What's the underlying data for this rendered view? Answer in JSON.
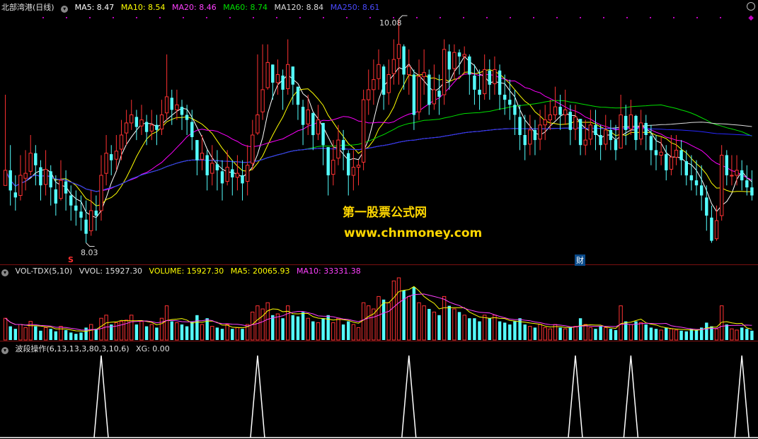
{
  "price_legend": {
    "title": "北部湾港(日线)",
    "ma5": "MA5: 8.47",
    "ma10": "MA10: 8.54",
    "ma20": "MA20: 8.46",
    "ma60": "MA60: 8.74",
    "ma120": "MA120: 8.84",
    "ma250": "MA250: 8.61"
  },
  "vol_legend": {
    "title": "VOL-TDX(5,10)",
    "vvol": "VVOL: 15927.30",
    "volume": "VOLUME: 15927.30",
    "ma5": "MA5: 20065.93",
    "ma10": "MA10: 33331.38"
  },
  "ind_legend": {
    "title": "波段操作(6,13,13,3,80,3,10,6)",
    "xg": "XG: 0.00"
  },
  "annotations": {
    "high": "10.08",
    "low": "8.03",
    "s_mark": "S",
    "cai": "财"
  },
  "watermark": {
    "line1": "第一股票公式网",
    "line2": "www.chnmoney.com"
  },
  "colors": {
    "up": "#ff3232",
    "down": "#54ffff",
    "ma5": "#ffffff",
    "ma10": "#ffff00",
    "ma20": "#ff00ff",
    "ma60": "#00e000",
    "ma120": "#dddddd",
    "ma250": "#2828ff"
  },
  "chart_data": {
    "type": "candlestick",
    "y_range": [
      7.9,
      10.3
    ],
    "close": [
      8.75,
      8.55,
      8.48,
      8.7,
      8.72,
      8.92,
      8.8,
      8.6,
      8.76,
      8.58,
      8.42,
      8.65,
      8.52,
      8.4,
      8.35,
      8.28,
      8.12,
      8.35,
      8.3,
      8.7,
      8.92,
      8.85,
      8.94,
      9.1,
      9.22,
      9.3,
      9.18,
      9.25,
      9.13,
      9.2,
      9.15,
      9.3,
      9.48,
      9.35,
      9.4,
      9.3,
      9.25,
      9.08,
      8.85,
      8.92,
      8.7,
      8.82,
      8.75,
      8.62,
      8.78,
      8.68,
      8.72,
      8.62,
      8.8,
      9.1,
      9.3,
      9.55,
      9.82,
      9.62,
      9.7,
      9.55,
      9.8,
      9.6,
      9.4,
      9.2,
      9.35,
      9.1,
      9.25,
      9.0,
      8.7,
      8.85,
      9.05,
      8.95,
      8.7,
      8.78,
      8.8,
      9.45,
      9.55,
      9.65,
      9.8,
      9.5,
      9.7,
      9.85,
      10.0,
      9.7,
      9.78,
      9.3,
      9.68,
      9.72,
      9.4,
      9.55,
      9.48,
      9.95,
      9.75,
      9.92,
      9.88,
      9.9,
      9.7,
      9.55,
      9.5,
      9.75,
      9.6,
      9.75,
      9.5,
      9.45,
      9.4,
      9.3,
      9.1,
      9.0,
      9.15,
      9.05,
      9.2,
      9.25,
      9.3,
      9.38,
      9.3,
      9.35,
      9.15,
      9.28,
      9.0,
      9.05,
      9.2,
      9.1,
      9.0,
      9.15,
      9.05,
      8.95,
      9.3,
      9.15,
      9.3,
      9.05,
      9.22,
      9.1,
      8.95,
      8.9,
      8.93,
      8.75,
      8.88,
      8.95,
      8.85,
      8.7,
      8.65,
      8.6,
      8.5,
      8.3,
      8.05,
      8.25,
      8.9,
      8.7,
      8.7,
      8.75,
      8.65,
      8.58,
      8.5
    ],
    "high": [
      9.5,
      9.0,
      8.7,
      8.9,
      8.95,
      9.1,
      9.0,
      8.85,
      8.95,
      8.8,
      8.7,
      8.85,
      8.75,
      8.6,
      8.55,
      8.5,
      8.45,
      8.55,
      8.5,
      8.9,
      9.1,
      9.0,
      9.1,
      9.25,
      9.35,
      9.45,
      9.35,
      9.4,
      9.3,
      9.35,
      9.3,
      9.45,
      9.9,
      9.55,
      9.55,
      9.45,
      9.4,
      9.35,
      9.05,
      9.1,
      8.95,
      9.0,
      8.95,
      8.85,
      8.95,
      8.85,
      8.9,
      8.85,
      9.0,
      9.25,
      9.9,
      10.0,
      10.0,
      9.8,
      9.85,
      9.75,
      10.05,
      9.75,
      9.55,
      9.45,
      9.5,
      9.3,
      9.4,
      9.2,
      8.95,
      9.05,
      9.2,
      9.15,
      8.95,
      8.95,
      8.85,
      9.55,
      9.75,
      9.85,
      9.95,
      9.8,
      9.85,
      10.05,
      10.25,
      10.0,
      9.95,
      9.75,
      9.85,
      9.95,
      9.75,
      9.8,
      9.7,
      10.05,
      10.0,
      10.0,
      9.95,
      9.98,
      9.9,
      9.8,
      9.75,
      9.9,
      9.85,
      9.88,
      9.8,
      9.7,
      9.65,
      9.55,
      9.4,
      9.3,
      9.3,
      9.25,
      9.35,
      9.4,
      9.45,
      9.58,
      9.5,
      9.55,
      9.4,
      9.4,
      9.25,
      9.25,
      9.35,
      9.35,
      9.2,
      9.3,
      9.25,
      9.2,
      9.5,
      9.4,
      9.45,
      9.3,
      9.35,
      9.3,
      9.2,
      9.1,
      9.08,
      9.0,
      9.1,
      9.1,
      9.05,
      8.95,
      8.9,
      8.85,
      8.8,
      8.6,
      8.4,
      8.4,
      9.0,
      8.95,
      8.9,
      8.9,
      8.85,
      8.8,
      8.75
    ],
    "low": [
      8.6,
      8.4,
      8.35,
      8.45,
      8.55,
      8.7,
      8.6,
      8.45,
      8.5,
      8.4,
      8.3,
      8.45,
      8.35,
      8.25,
      8.2,
      8.15,
      8.03,
      8.1,
      8.15,
      8.25,
      8.6,
      8.7,
      8.75,
      8.85,
      9.0,
      9.15,
      9.05,
      9.1,
      9.0,
      9.05,
      9.0,
      9.1,
      9.25,
      9.2,
      9.25,
      9.15,
      9.1,
      8.95,
      8.7,
      8.75,
      8.55,
      8.6,
      8.55,
      8.45,
      8.6,
      8.5,
      8.55,
      8.45,
      8.5,
      8.75,
      9.1,
      9.25,
      9.55,
      9.45,
      9.5,
      9.35,
      9.5,
      9.4,
      9.25,
      9.0,
      9.1,
      8.95,
      9.05,
      8.8,
      8.5,
      8.6,
      8.8,
      8.75,
      8.5,
      8.55,
      8.6,
      8.75,
      9.3,
      9.4,
      9.55,
      9.35,
      9.4,
      9.6,
      9.6,
      9.55,
      9.5,
      9.15,
      9.25,
      9.5,
      9.3,
      9.35,
      9.3,
      9.4,
      9.55,
      9.65,
      9.7,
      9.7,
      9.5,
      9.4,
      9.35,
      9.45,
      9.45,
      9.5,
      9.35,
      9.3,
      9.25,
      9.1,
      8.95,
      8.85,
      8.9,
      8.9,
      8.95,
      9.05,
      9.15,
      9.25,
      9.15,
      9.2,
      9.0,
      9.05,
      8.9,
      8.9,
      9.0,
      8.95,
      8.85,
      8.95,
      8.95,
      8.85,
      9.0,
      9.0,
      9.1,
      8.95,
      9.0,
      8.95,
      8.8,
      8.75,
      8.8,
      8.65,
      8.7,
      8.8,
      8.7,
      8.6,
      8.55,
      8.5,
      8.35,
      8.15,
      8.03,
      8.05,
      8.25,
      8.6,
      8.6,
      8.6,
      8.55,
      8.5,
      8.45
    ],
    "open_delta": [
      -0.15,
      0.2,
      0.05,
      -0.2,
      -0.05,
      -0.18,
      0.12,
      0.18,
      -0.15,
      0.16,
      0.14,
      -0.18,
      0.12,
      0.1,
      0.05,
      0.06,
      0.14,
      -0.2,
      0.05,
      -0.35,
      -0.2,
      0.06,
      -0.08,
      -0.14,
      -0.1,
      -0.08,
      0.1,
      -0.06,
      0.1,
      -0.06,
      0.05,
      -0.14,
      -0.16,
      0.12,
      -0.05,
      0.08,
      0.05,
      0.15,
      0.2,
      -0.06,
      0.2,
      -0.1,
      0.06,
      0.12,
      -0.14,
      0.08,
      -0.04,
      0.08,
      -0.16,
      -0.28,
      -0.18,
      -0.22,
      -0.25,
      0.18,
      -0.08,
      0.14,
      -0.24,
      0.18,
      0.18,
      0.18,
      -0.14,
      0.22,
      -0.14,
      0.22,
      0.28,
      -0.14,
      -0.18,
      0.1,
      0.22,
      -0.08,
      -0.02,
      -0.62,
      -0.1,
      -0.1,
      -0.14,
      0.28,
      -0.18,
      -0.14,
      -0.14,
      0.28,
      -0.08,
      0.4,
      -0.35,
      -0.04,
      0.3,
      -0.14,
      0.06,
      -0.45,
      0.18,
      -0.16,
      0.04,
      -0.02,
      0.18,
      0.14,
      0.05,
      -0.24,
      0.14,
      -0.14,
      0.24,
      0.05,
      0.05,
      0.1,
      0.18,
      0.1,
      -0.14,
      0.1,
      -0.14,
      -0.05,
      -0.05,
      -0.08,
      0.08,
      -0.05,
      0.18,
      -0.12,
      0.26,
      -0.05,
      -0.14,
      0.1,
      0.1,
      -0.14,
      0.1,
      0.1,
      -0.33,
      0.14,
      -0.14,
      0.24,
      -0.16,
      0.12,
      0.14,
      0.05,
      -0.03,
      0.16,
      -0.12,
      -0.07,
      0.1,
      0.14,
      0.05,
      0.05,
      0.1,
      0.18,
      0.23,
      -0.18,
      -0.6,
      0.2,
      0.0,
      -0.05,
      0.1,
      0.07,
      0.08
    ],
    "volume_relative": [
      0.35,
      0.22,
      0.18,
      0.25,
      0.2,
      0.3,
      0.22,
      0.15,
      0.2,
      0.18,
      0.14,
      0.22,
      0.16,
      0.12,
      0.1,
      0.12,
      0.2,
      0.25,
      0.18,
      0.35,
      0.4,
      0.25,
      0.28,
      0.3,
      0.32,
      0.4,
      0.25,
      0.3,
      0.22,
      0.25,
      0.2,
      0.35,
      0.55,
      0.3,
      0.28,
      0.25,
      0.22,
      0.3,
      0.4,
      0.25,
      0.35,
      0.22,
      0.2,
      0.18,
      0.25,
      0.18,
      0.2,
      0.18,
      0.25,
      0.45,
      0.55,
      0.5,
      0.6,
      0.4,
      0.42,
      0.35,
      0.55,
      0.4,
      0.38,
      0.45,
      0.35,
      0.3,
      0.28,
      0.35,
      0.4,
      0.28,
      0.35,
      0.25,
      0.3,
      0.25,
      0.2,
      0.6,
      0.55,
      0.5,
      0.7,
      0.65,
      0.6,
      0.95,
      1.0,
      0.8,
      0.7,
      0.85,
      0.6,
      0.55,
      0.5,
      0.45,
      0.4,
      0.7,
      0.55,
      0.5,
      0.45,
      0.4,
      0.35,
      0.35,
      0.3,
      0.4,
      0.35,
      0.4,
      0.3,
      0.28,
      0.25,
      0.3,
      0.35,
      0.25,
      0.22,
      0.2,
      0.25,
      0.2,
      0.18,
      0.25,
      0.2,
      0.18,
      0.2,
      0.22,
      0.35,
      0.25,
      0.2,
      0.18,
      0.22,
      0.2,
      0.18,
      0.16,
      0.55,
      0.3,
      0.25,
      0.3,
      0.28,
      0.25,
      0.2,
      0.18,
      0.16,
      0.2,
      0.18,
      0.16,
      0.15,
      0.14,
      0.18,
      0.16,
      0.2,
      0.28,
      0.22,
      0.18,
      0.55,
      0.25,
      0.18,
      0.16,
      0.2,
      0.18,
      0.15
    ],
    "signal_bars": [
      19,
      50,
      80,
      113,
      124,
      146,
      162,
      171
    ]
  }
}
